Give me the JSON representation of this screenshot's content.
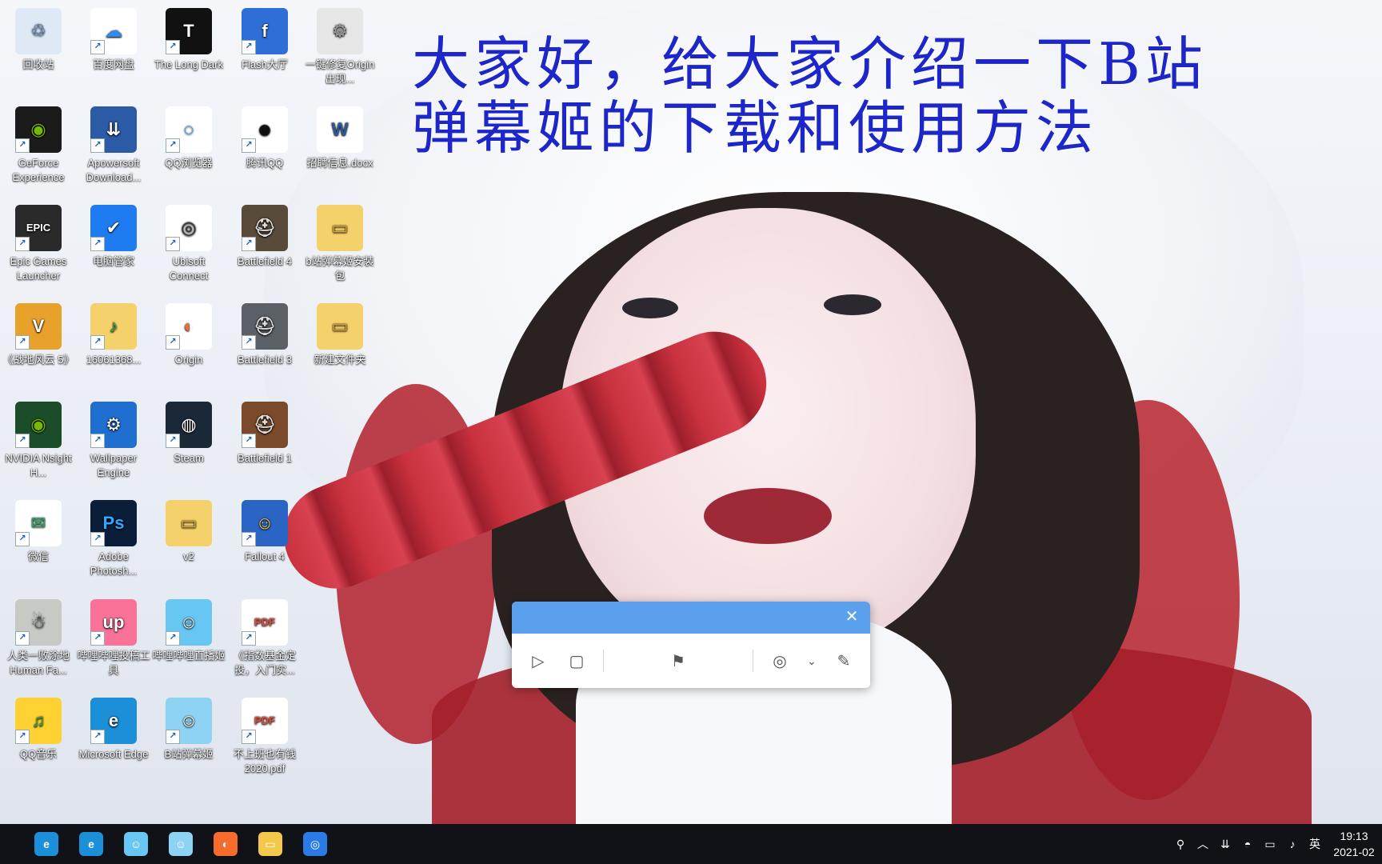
{
  "headline": {
    "line1": "大家好，给大家介绍一下B站",
    "line2": "弹幕姬的下载和使用方法"
  },
  "desktop_icons": [
    {
      "label": "回收站",
      "icon": "recycle-bin-icon"
    },
    {
      "label": "百度网盘",
      "icon": "baidu-netdisk-icon"
    },
    {
      "label": "The Long Dark",
      "icon": "the-long-dark-icon"
    },
    {
      "label": "Flash大厅",
      "icon": "flash-hall-icon"
    },
    {
      "label": "一键修复Origin出现...",
      "icon": "settings-gears-icon"
    },
    {
      "label": "GeForce Experience",
      "icon": "nvidia-icon"
    },
    {
      "label": "Apowersoft Download...",
      "icon": "apowersoft-icon"
    },
    {
      "label": "QQ浏览器",
      "icon": "qq-browser-icon"
    },
    {
      "label": "腾讯QQ",
      "icon": "qq-penguin-icon"
    },
    {
      "label": "招聘信息.docx",
      "icon": "word-document-icon"
    },
    {
      "label": "Epic Games Launcher",
      "icon": "epic-games-icon"
    },
    {
      "label": "电脑管家",
      "icon": "pc-manager-icon"
    },
    {
      "label": "Ubisoft Connect",
      "icon": "ubisoft-icon"
    },
    {
      "label": "Battlefield 4",
      "icon": "battlefield-4-icon"
    },
    {
      "label": "b站弹幕姬安装包",
      "icon": "folder-icon"
    },
    {
      "label": "《战地风云 5》",
      "icon": "gta-v-icon"
    },
    {
      "label": "16061368...",
      "icon": "music-folder-icon"
    },
    {
      "label": "Origin",
      "icon": "origin-icon"
    },
    {
      "label": "Battlefield 3",
      "icon": "battlefield-3-icon"
    },
    {
      "label": "新建文件夹",
      "icon": "folder-icon"
    },
    {
      "label": "NVIDIA Nsight H...",
      "icon": "nvidia-nsight-icon"
    },
    {
      "label": "Wallpaper Engine",
      "icon": "wallpaper-engine-icon"
    },
    {
      "label": "Steam",
      "icon": "steam-icon"
    },
    {
      "label": "Battlefield 1",
      "icon": "battlefield-1-icon"
    },
    {
      "label": "微信",
      "icon": "wechat-icon"
    },
    {
      "label": "Adobe Photosh...",
      "icon": "photoshop-icon"
    },
    {
      "label": "v2",
      "icon": "folder-icon"
    },
    {
      "label": "Fallout 4",
      "icon": "fallout-4-icon"
    },
    {
      "label": "人类一败涂地 Human Fa...",
      "icon": "human-fall-flat-icon"
    },
    {
      "label": "哔哩哔哩投稿工具",
      "icon": "bilibili-upload-icon"
    },
    {
      "label": "哔哩哔哩直播姬",
      "icon": "bilibili-live-icon"
    },
    {
      "label": "《指数基金定投，入门实...",
      "icon": "pdf-icon"
    },
    {
      "label": "QQ音乐",
      "icon": "qq-music-icon"
    },
    {
      "label": "Microsoft Edge",
      "icon": "edge-icon"
    },
    {
      "label": "B站弹幕姬",
      "icon": "bilibili-danmaku-icon"
    },
    {
      "label": "不上班也有钱2020.pdf",
      "icon": "pdf-icon"
    }
  ],
  "recorder": {
    "tools": [
      "play-icon",
      "stop-icon",
      "flag-icon",
      "webcam-icon",
      "chevron-down-icon",
      "pencil-icon"
    ]
  },
  "taskbar": {
    "apps": [
      "edge-icon",
      "edge-icon",
      "bilibili-live-icon",
      "bilibili-danmaku-icon",
      "origin-icon",
      "file-explorer-icon",
      "screen-recorder-icon"
    ],
    "tray": {
      "input_method": "英",
      "time": "19:13",
      "date": "2021-02"
    }
  }
}
